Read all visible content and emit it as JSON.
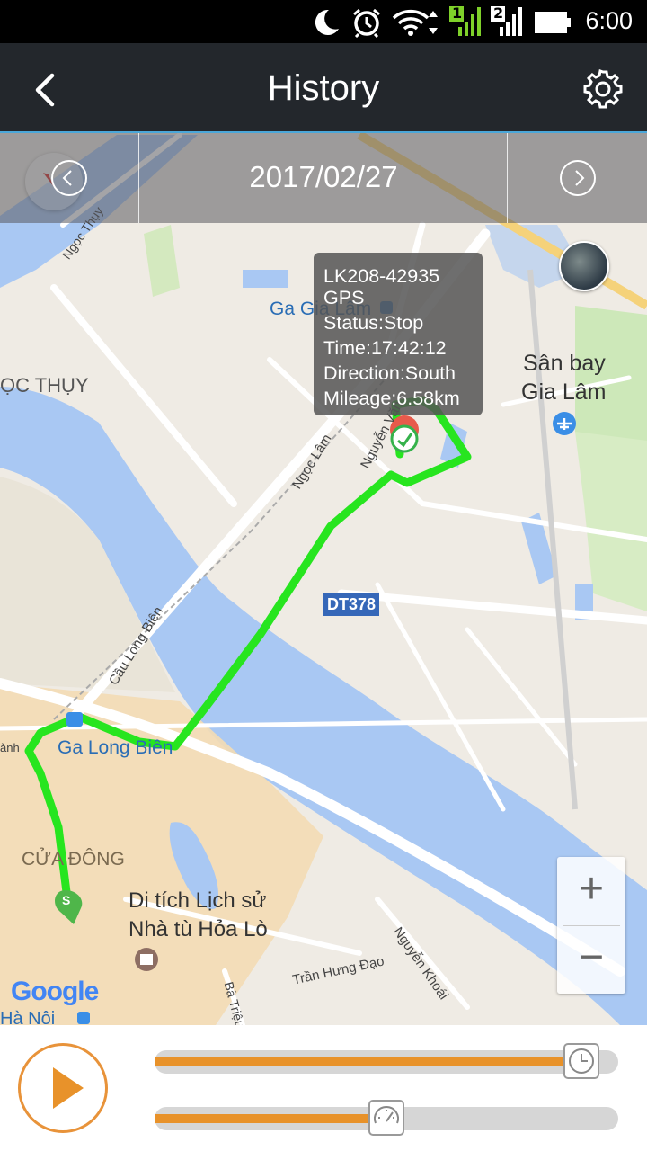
{
  "statusbar": {
    "time": "6:00",
    "sim1": "1",
    "sim2": "2"
  },
  "header": {
    "title": "History"
  },
  "datebar": {
    "date": "2017/02/27"
  },
  "popup": {
    "device": "LK208-42935",
    "source": "GPS",
    "status": "Status:Stop",
    "time": "Time:17:42:12",
    "direction": "Direction:South",
    "mileage": "Mileage:6.58km"
  },
  "map": {
    "labels": {
      "ga_gia_lam": "Ga Gia Lâm",
      "san_bay_1": "Sân bay",
      "san_bay_2": "Gia Lâm",
      "ngoc_thuy": "ỌC THỤY",
      "ngoc_thuy_road": "Ngọc Thụy",
      "ngoc_lam": "Ngọc Lâm",
      "nguyen_van": "Nguyễn Văn",
      "dt378": "DT378",
      "cau_long_bien": "Cầu Long Biên",
      "ga_long_bien": "Ga Long Biên",
      "cua_dong": "CỬA ĐÔNG",
      "di_tich_1": "Di tích Lịch sử",
      "di_tich_2": "Nhà tù Hỏa Lò",
      "tran_hung_dao": "Trần Hưng Đạo",
      "nguyen_khoai": "Nguyễn Khoái",
      "ha_noi": "Hà Nội",
      "ba_trieu": "Bà Triệu",
      "anh": "ành",
      "google": "Google"
    },
    "route_color": "#27e51f",
    "start_marker_label": "S"
  },
  "zoom": {
    "plus": "+",
    "minus": "−"
  },
  "playback": {
    "progress": 0.92,
    "speed": 0.5,
    "accent": "#e8922a"
  }
}
